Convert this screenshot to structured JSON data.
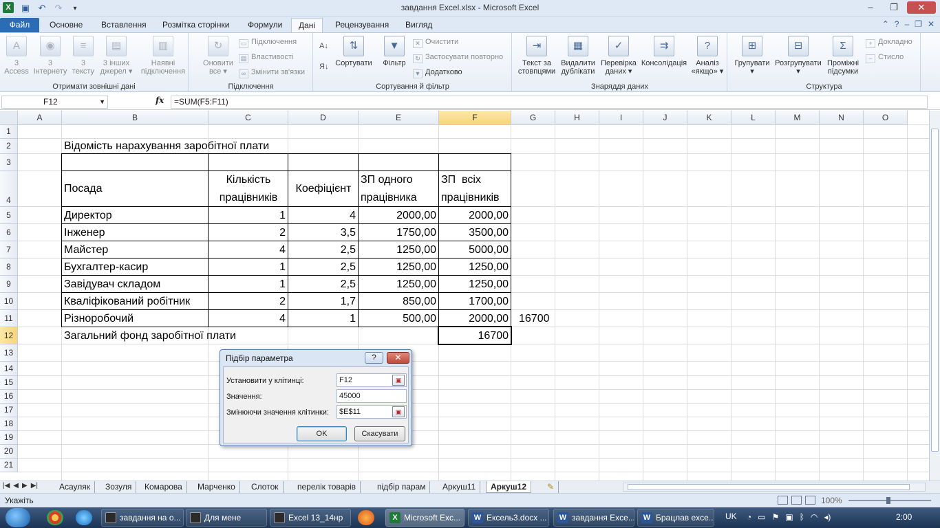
{
  "window": {
    "title": "завдання Excel.xlsx - Microsoft Excel",
    "app_icon": "X"
  },
  "ribbon_tabs": [
    "Файл",
    "Основне",
    "Вставлення",
    "Розмітка сторінки",
    "Формули",
    "Дані",
    "Рецензування",
    "Вигляд"
  ],
  "active_tab": "Дані",
  "ribbon": {
    "get_external": {
      "label": "Отримати зовнішні дані",
      "buttons": [
        {
          "top": "3",
          "bottom": "Access",
          "icon": "access-icon"
        },
        {
          "top": "3",
          "bottom": "Інтернету",
          "icon": "web-icon"
        },
        {
          "top": "3",
          "bottom": "тексту",
          "icon": "text-file-icon"
        },
        {
          "top": "3 інших",
          "bottom": "джерел ▾",
          "icon": "other-sources-icon"
        },
        {
          "top": "Наявні",
          "bottom": "підключення",
          "icon": "existing-connections-icon"
        }
      ]
    },
    "connections": {
      "label": "Підключення",
      "refresh_top": "Оновити",
      "refresh_bottom": "все ▾",
      "items": [
        "Підключення",
        "Властивості",
        "Змінити зв'язки"
      ]
    },
    "sort_filter": {
      "label": "Сортування й фільтр",
      "sort": "Сортувати",
      "filter": "Фільтр",
      "items": [
        "Очистити",
        "Застосувати повторно",
        "Додатково"
      ]
    },
    "data_tools": {
      "label": "Знаряддя даних",
      "buttons": [
        {
          "top": "Текст за",
          "bottom": "стовпцями"
        },
        {
          "top": "Видалити",
          "bottom": "дублікати"
        },
        {
          "top": "Перевірка",
          "bottom": "даних ▾"
        },
        {
          "top": "Консолідація",
          "bottom": ""
        },
        {
          "top": "Аналіз",
          "bottom": "«якщо» ▾"
        }
      ]
    },
    "outline": {
      "label": "Структура",
      "buttons": [
        {
          "top": "Групувати",
          "bottom": "▾"
        },
        {
          "top": "Розгрупувати",
          "bottom": "▾"
        },
        {
          "top": "Проміжні",
          "bottom": "підсумки"
        }
      ],
      "items": [
        "Докладно",
        "Стисло"
      ]
    }
  },
  "formula_bar": {
    "name_box": "F12",
    "fx": "fx",
    "formula": "=SUM(F5:F11)"
  },
  "columns": [
    "A",
    "B",
    "C",
    "D",
    "E",
    "F",
    "G",
    "H",
    "I",
    "J",
    "K",
    "L",
    "M",
    "N",
    "O"
  ],
  "selected_column": "F",
  "rows": [
    "1",
    "2",
    "3",
    "4",
    "5",
    "6",
    "7",
    "8",
    "9",
    "10",
    "11",
    "12",
    "13",
    "14",
    "15",
    "16",
    "17",
    "18",
    "19",
    "20",
    "21"
  ],
  "selected_row": "12",
  "sheet": {
    "title": "Відомість нарахування заробітної плати",
    "headers": {
      "b": "Посада",
      "c1": "Кількість",
      "c2": "працівників",
      "d": "Коефіцієнт",
      "e1": "ЗП одного",
      "e2": "працівника",
      "f1": "ЗП  всіх",
      "f2": "працівників"
    },
    "rows": [
      {
        "position": "Директор",
        "count": "1",
        "coef": "4",
        "salary_one": "2000,00",
        "salary_all": "2000,00"
      },
      {
        "position": "Інженер",
        "count": "2",
        "coef": "3,5",
        "salary_one": "1750,00",
        "salary_all": "3500,00"
      },
      {
        "position": "Майстер",
        "count": "4",
        "coef": "2,5",
        "salary_one": "1250,00",
        "salary_all": "5000,00"
      },
      {
        "position": "Бухгалтер-касир",
        "count": "1",
        "coef": "2,5",
        "salary_one": "1250,00",
        "salary_all": "1250,00"
      },
      {
        "position": "Завідувач складом",
        "count": "1",
        "coef": "2,5",
        "salary_one": "1250,00",
        "salary_all": "1250,00"
      },
      {
        "position": "Кваліфікований робітник",
        "count": "2",
        "coef": "1,7",
        "salary_one": "850,00",
        "salary_all": "1700,00"
      },
      {
        "position": "Різноробочий",
        "count": "4",
        "coef": "1",
        "salary_one": "500,00",
        "salary_all": "2000,00"
      }
    ],
    "g11": "16700",
    "total_label": "Загальний фонд заробітної плати",
    "total_value": "16700"
  },
  "dialog": {
    "title": "Підбір параметра",
    "help": "?",
    "close": "✕",
    "set_cell_label": "Установити у клітинці:",
    "set_cell_value": "F12",
    "value_label": "Значення:",
    "value_value": "45000",
    "changing_label": "Змінюючи значення клітинки:",
    "changing_value": "$E$11",
    "ok": "OK",
    "cancel": "Скасувати"
  },
  "sheet_tabs": [
    "Асауляк",
    "Зозуля",
    "Комарова",
    "Марченко",
    "Слоток",
    "перелік товарів",
    "підбір парам",
    "Аркуш11",
    "Аркуш12"
  ],
  "active_sheet": "Аркуш12",
  "status": {
    "mode": "Укажіть",
    "zoom": "100%"
  },
  "taskbar": {
    "buttons": [
      {
        "label": "завдання на о...",
        "icon": "window-icon"
      },
      {
        "label": "Для мене",
        "icon": "window-icon"
      },
      {
        "label": "Excel 13_14нр",
        "icon": "window-icon"
      },
      {
        "label": "Microsoft Exc...",
        "icon": "excel-icon"
      },
      {
        "label": "Ексель3.docx ...",
        "icon": "word-icon"
      },
      {
        "label": "завдання Exce...",
        "icon": "word-icon"
      },
      {
        "label": "Брацлав exce...",
        "icon": "word-icon"
      }
    ],
    "lang": "UK",
    "clock": "2:00"
  },
  "colors": {
    "file_tab": "#2a6db5",
    "selected_header": "#f7d67a",
    "excel_green": "#1f7a3a",
    "word_blue": "#2b579a"
  }
}
